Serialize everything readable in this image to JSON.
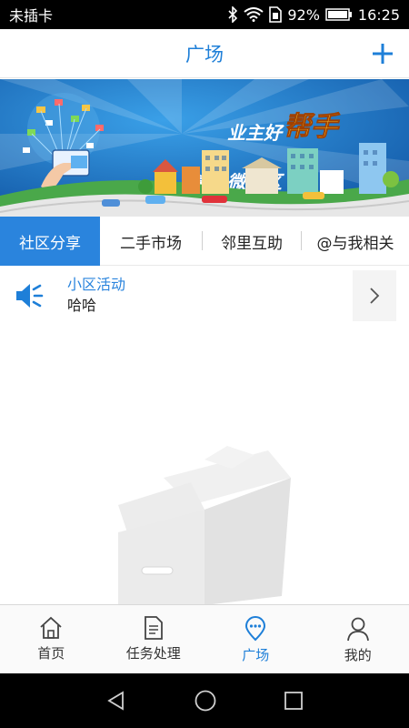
{
  "status_bar": {
    "carrier": "未插卡",
    "battery": "92%",
    "time": "16:25"
  },
  "header": {
    "title": "广场",
    "add_icon": "plus-icon"
  },
  "banner": {
    "headline_1": "掌上微社区",
    "headline_2": "业主好",
    "headline_3": "帮手"
  },
  "tabs": [
    {
      "label": "社区分享",
      "active": true
    },
    {
      "label": "二手市场",
      "active": false
    },
    {
      "label": "邻里互助",
      "active": false
    },
    {
      "label": "@与我相关",
      "active": false
    }
  ],
  "notice": {
    "icon": "speaker-icon",
    "title": "小区活动",
    "body": "哈哈"
  },
  "bottom_nav": [
    {
      "label": "首页",
      "icon": "home-icon",
      "active": false
    },
    {
      "label": "任务处理",
      "icon": "document-icon",
      "active": false
    },
    {
      "label": "广场",
      "icon": "location-chat-icon",
      "active": true
    },
    {
      "label": "我的",
      "icon": "user-icon",
      "active": false
    }
  ],
  "colors": {
    "accent": "#1e7fd8",
    "tab_active": "#2a84dd"
  }
}
